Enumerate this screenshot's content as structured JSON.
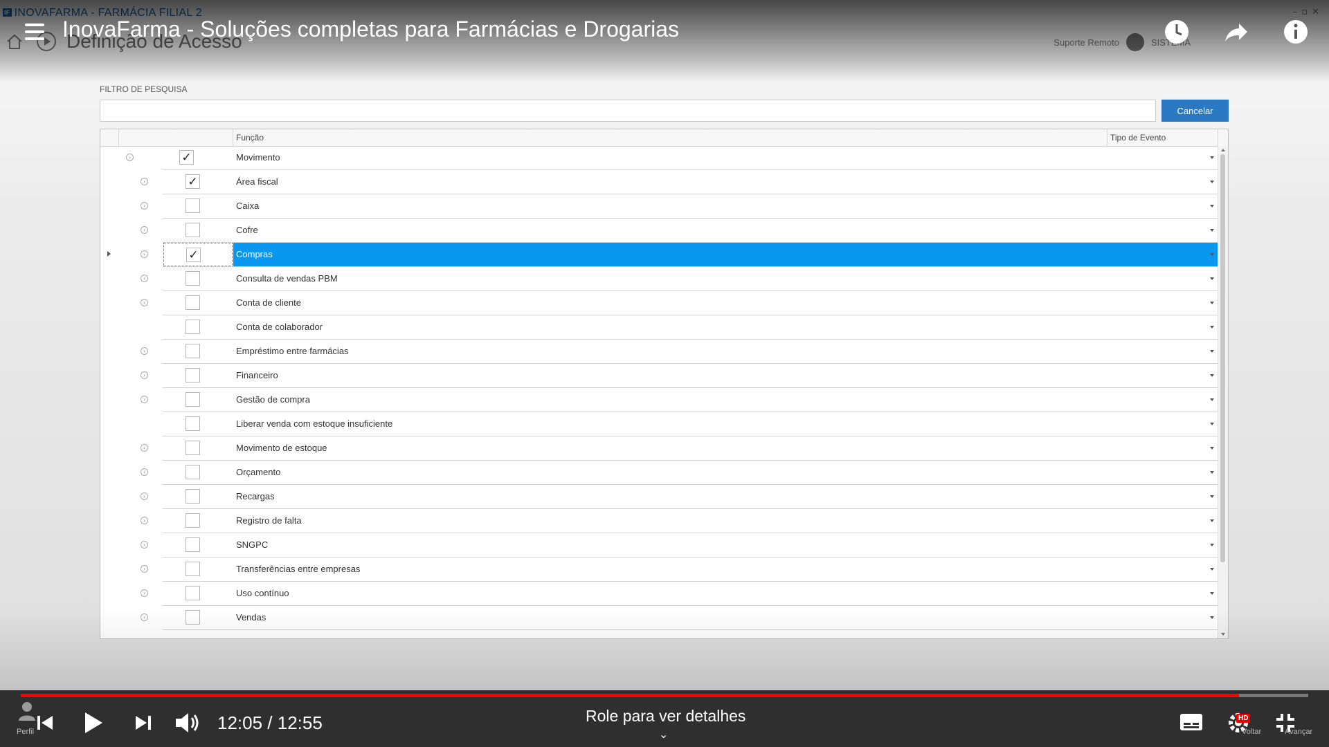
{
  "window": {
    "title": "INOVAFARMA - FARMÁCIA FILIAL 2"
  },
  "page": {
    "title": "Definição de Acesso"
  },
  "topbar": {
    "remote_support": "Suporte Remoto",
    "system": "SISTEMA"
  },
  "video": {
    "title": "InovaFarma - Soluções completas para Farmácias e Drogarias",
    "time": "12:05 / 12:55",
    "hint": "Role para ver detalhes",
    "progress": 0.946,
    "left_caption": "Perfil",
    "back_caption": "Voltar",
    "forward_caption": "Avançar",
    "hd": "HD"
  },
  "filter": {
    "label": "FILTRO DE PESQUISA",
    "value": "",
    "cancel_label": "Cancelar"
  },
  "grid": {
    "columns": {
      "funcao": "Função",
      "tipo_evento": "Tipo de Evento"
    },
    "rows": [
      {
        "label": "Movimento",
        "checked": true,
        "level": 0,
        "has_expand": true,
        "selected": false
      },
      {
        "label": "Área fiscal",
        "checked": true,
        "level": 1,
        "has_expand": true,
        "selected": false
      },
      {
        "label": "Caixa",
        "checked": false,
        "level": 1,
        "has_expand": true,
        "selected": false
      },
      {
        "label": "Cofre",
        "checked": false,
        "level": 1,
        "has_expand": true,
        "selected": false
      },
      {
        "label": "Compras",
        "checked": true,
        "level": 1,
        "has_expand": true,
        "selected": true
      },
      {
        "label": "Consulta de vendas PBM",
        "checked": false,
        "level": 1,
        "has_expand": true,
        "selected": false
      },
      {
        "label": "Conta de cliente",
        "checked": false,
        "level": 1,
        "has_expand": true,
        "selected": false
      },
      {
        "label": "Conta de colaborador",
        "checked": false,
        "level": 1,
        "has_expand": false,
        "selected": false
      },
      {
        "label": "Empréstimo entre farmácias",
        "checked": false,
        "level": 1,
        "has_expand": true,
        "selected": false
      },
      {
        "label": "Financeiro",
        "checked": false,
        "level": 1,
        "has_expand": true,
        "selected": false
      },
      {
        "label": "Gestão de compra",
        "checked": false,
        "level": 1,
        "has_expand": true,
        "selected": false
      },
      {
        "label": "Liberar venda com estoque insuficiente",
        "checked": false,
        "level": 1,
        "has_expand": false,
        "selected": false
      },
      {
        "label": "Movimento de estoque",
        "checked": false,
        "level": 1,
        "has_expand": true,
        "selected": false
      },
      {
        "label": "Orçamento",
        "checked": false,
        "level": 1,
        "has_expand": true,
        "selected": false
      },
      {
        "label": "Recargas",
        "checked": false,
        "level": 1,
        "has_expand": true,
        "selected": false
      },
      {
        "label": "Registro de falta",
        "checked": false,
        "level": 1,
        "has_expand": true,
        "selected": false
      },
      {
        "label": "SNGPC",
        "checked": false,
        "level": 1,
        "has_expand": true,
        "selected": false
      },
      {
        "label": "Transferências entre empresas",
        "checked": false,
        "level": 1,
        "has_expand": true,
        "selected": false
      },
      {
        "label": "Uso contínuo",
        "checked": false,
        "level": 1,
        "has_expand": true,
        "selected": false
      },
      {
        "label": "Vendas",
        "checked": false,
        "level": 1,
        "has_expand": true,
        "selected": false
      }
    ]
  }
}
